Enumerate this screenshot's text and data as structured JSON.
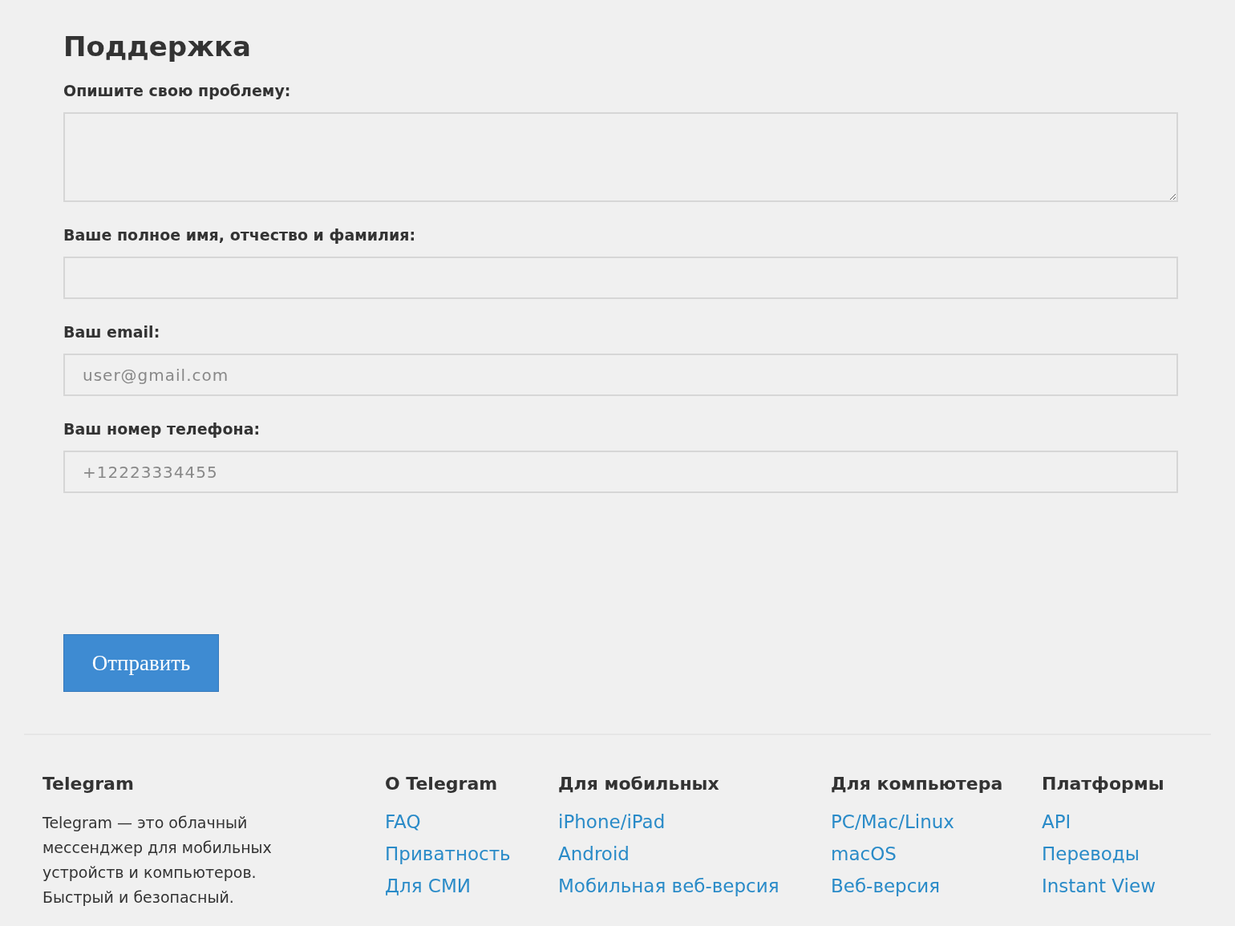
{
  "title": "Поддержка",
  "fields": [
    {
      "label": "Опишите свою проблему:",
      "kind": "textarea"
    },
    {
      "label": "Ваше полное имя, отчество и фамилия:",
      "kind": "text"
    },
    {
      "label": "Ваш email:",
      "kind": "text",
      "placeholder": "user@gmail.com"
    },
    {
      "label": "Ваш номер телефона:",
      "kind": "text",
      "placeholder": "+12223334455"
    }
  ],
  "submit_button": "Отправить",
  "footer": {
    "about": {
      "heading": "Telegram",
      "text": "Telegram — это облачный мессенджер для мобильных устройств и компьютеров. Быстрый и безопасный."
    },
    "columns": [
      {
        "heading": "О Telegram",
        "links": [
          "FAQ",
          "Приватность",
          "Для СМИ"
        ]
      },
      {
        "heading": "Для мобильных",
        "links": [
          "iPhone/iPad",
          "Android",
          "Мобильная веб-версия"
        ]
      },
      {
        "heading": "Для компьютера",
        "links": [
          "PC/Mac/Linux",
          "macOS",
          "Веб-версия"
        ]
      },
      {
        "heading": "Платформы",
        "links": [
          "API",
          "Переводы",
          "Instant View"
        ]
      }
    ]
  }
}
